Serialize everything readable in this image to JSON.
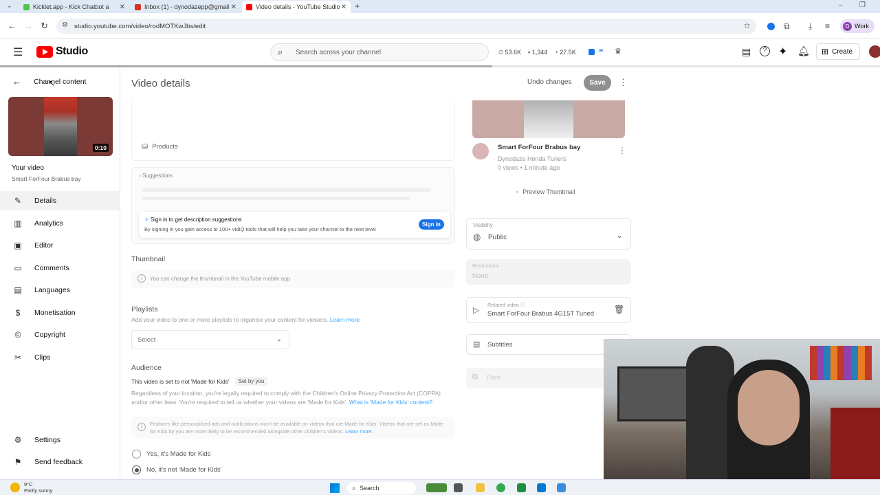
{
  "browser": {
    "tabs": [
      {
        "title": "Kicklet.app - Kick Chatbot a",
        "color": "#53c449"
      },
      {
        "title": "Inbox (1) - dynodazepp@gmail",
        "color": "#d93025"
      },
      {
        "title": "Video details - YouTube Studio",
        "color": "#ff0000"
      }
    ],
    "url": "studio.youtube.com/video/rodMOTKwJbs/edit",
    "profile_initial": "D",
    "profile_label": "Work"
  },
  "studio": {
    "logo": "Studio",
    "search_placeholder": "Search across your channel",
    "stats": [
      "53.6K",
      "1,344",
      "27.5K"
    ],
    "create_label": "Create"
  },
  "sidebar": {
    "back_label": "Channel content",
    "duration": "0:10",
    "your_video": "Your video",
    "video_title": "Smart ForFour Brabus bay",
    "items": [
      {
        "label": "Details",
        "icon": "pencil-icon"
      },
      {
        "label": "Analytics",
        "icon": "analytics-icon"
      },
      {
        "label": "Editor",
        "icon": "editor-icon"
      },
      {
        "label": "Comments",
        "icon": "comments-icon"
      },
      {
        "label": "Languages",
        "icon": "languages-icon"
      },
      {
        "label": "Monetisation",
        "icon": "dollar-icon"
      },
      {
        "label": "Copyright",
        "icon": "copyright-icon"
      },
      {
        "label": "Clips",
        "icon": "scissors-icon"
      }
    ],
    "settings": "Settings",
    "feedback": "Send feedback"
  },
  "page": {
    "title": "Video details",
    "undo": "Undo changes",
    "save": "Save",
    "products": "Products",
    "suggestions": "Suggestions",
    "signin_title": "Sign in to get description suggestions",
    "signin_body": "By signing in you gain access to 100+ vidIQ tools that will help you take your channel to the next level",
    "signin_btn": "Sign in",
    "thumbnail_h": "Thumbnail",
    "thumbnail_note": "You can change the thumbnail in the YouTube mobile app",
    "playlists_h": "Playlists",
    "playlists_note": "Add your video to one or more playlists to organise your content for viewers.",
    "learn_more": "Learn more",
    "select": "Select",
    "audience_h": "Audience",
    "audience_status": "This video is set to not 'Made for Kids'",
    "set_by_you": "Set by you",
    "audience_body": "Regardless of your location, you're legally required to comply with the Children's Online Privacy Protection Act (COPPA) and/or other laws. You're required to tell us whether your videos are 'Made for Kids'.",
    "audience_link": "What is 'Made for Kids' content?",
    "kids_note": "Features like personalised ads and notifications won't be available on videos that are Made for Kids. Videos that are set as Made for Kids by you are more likely to be recommended alongside other children's videos.",
    "kids_learn": "Learn more.",
    "radio_yes": "Yes, it's Made for Kids",
    "radio_no": "No, it's not 'Made for Kids'"
  },
  "right": {
    "video_title": "Smart ForFour Brabus bay",
    "channel": "Dynodaze Honda Tuners",
    "meta": "0 views • 1 minute ago",
    "preview": "Preview Thumbnail",
    "visibility_label": "Visibility",
    "visibility_value": "Public",
    "restrictions_label": "Restrictions",
    "restrictions_value": "None",
    "related_label": "Related video",
    "related_value": "Smart ForFour Brabus 4G15T Tuned",
    "subtitles": "Subtitles",
    "files": "Files"
  },
  "taskbar": {
    "temp": "9°C",
    "weather": "Partly sunny",
    "search": "Search"
  }
}
